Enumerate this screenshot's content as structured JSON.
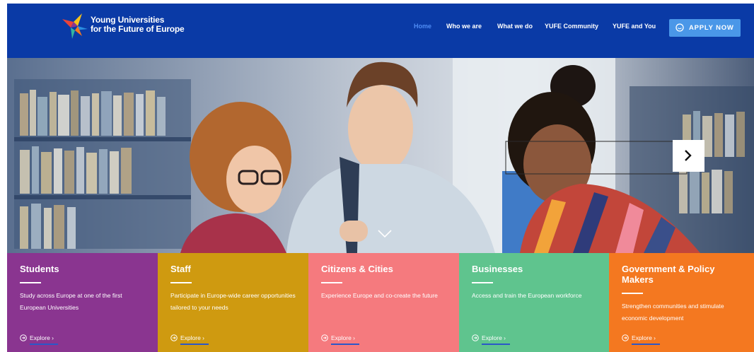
{
  "brand": {
    "logo_line1": "Young Universities",
    "logo_line2": "for the Future of Europe"
  },
  "nav": {
    "items": [
      {
        "label": "Home",
        "active": true
      },
      {
        "label": "Who we are",
        "active": false
      },
      {
        "label": "What we do",
        "active": false
      },
      {
        "label": "YUFE Community",
        "active": false
      },
      {
        "label": "YUFE and You",
        "active": false
      }
    ],
    "apply_label": "APPLY NOW"
  },
  "hero": {
    "icon_next": "chevron-right-icon",
    "icon_scroll": "chevron-down-icon"
  },
  "tiles": [
    {
      "title": "Students",
      "description": "Study across Europe at one of the first European Universities",
      "explore": "Explore ›",
      "color": "#8a3590"
    },
    {
      "title": "Staff",
      "description": "Participate in Europe-wide career opportunities tailored to your needs",
      "explore": "Explore ›",
      "color": "#cf9a10"
    },
    {
      "title": "Citizens & Cities",
      "description": "Experience Europe and co-create the future",
      "explore": "Explore ›",
      "color": "#f57a7e"
    },
    {
      "title": "Businesses",
      "description": "Access and train the European workforce",
      "explore": "Explore ›",
      "color": "#5fc48e"
    },
    {
      "title": "Government & Policy Makers",
      "description": "Strengthen communities and stimulate economic development",
      "explore": "Explore ›",
      "color": "#f47820"
    }
  ],
  "colors": {
    "header_bg": "#0a3aa6",
    "accent_button": "#4a97e8",
    "nav_active": "#4f8cf5"
  }
}
